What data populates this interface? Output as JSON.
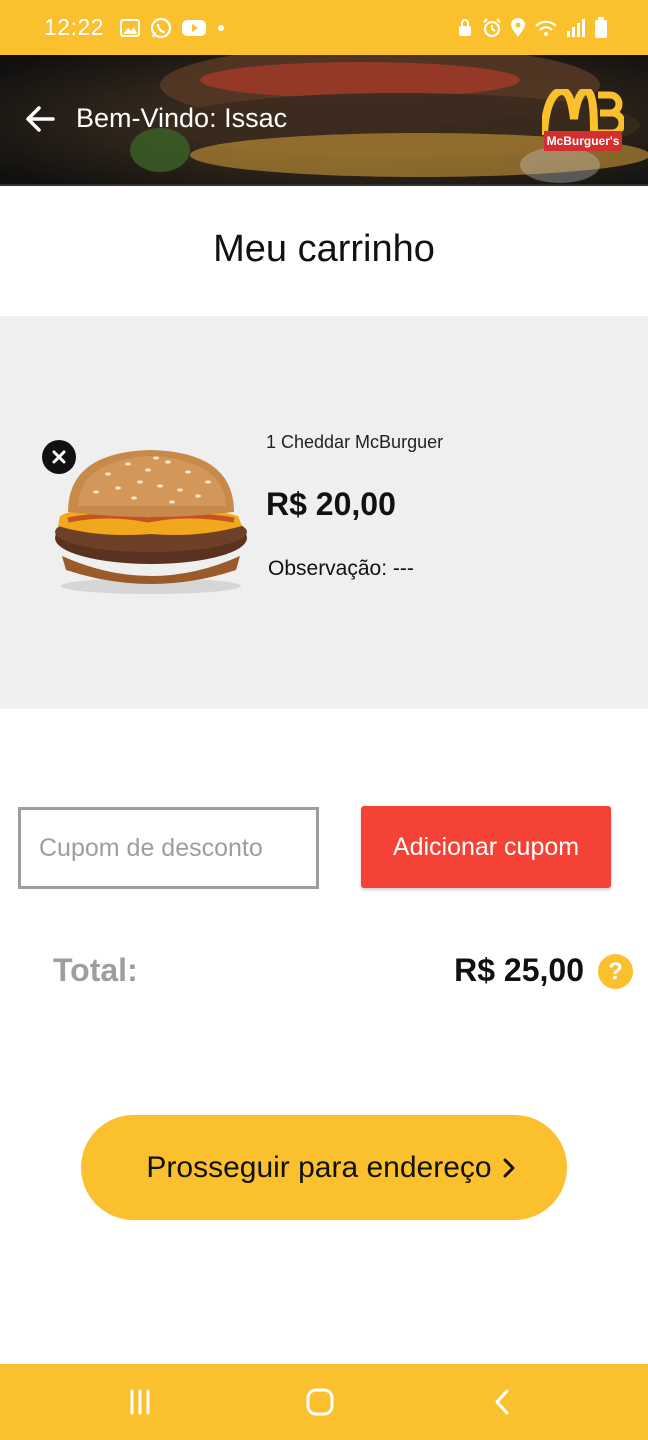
{
  "status_bar": {
    "time": "12:22",
    "left_icons": [
      "gallery-icon",
      "whatsapp-icon",
      "youtube-icon",
      "dot-icon"
    ],
    "right_icons": [
      "lock-icon",
      "alarm-icon",
      "location-icon",
      "wifi-icon",
      "signal-icon",
      "battery-icon"
    ]
  },
  "header": {
    "title": "Bem-Vindo: Issac",
    "logo_text": "McBurguer's"
  },
  "page": {
    "title": "Meu carrinho"
  },
  "cart": {
    "items": [
      {
        "name": "1 Cheddar McBurguer",
        "price": "R$ 20,00",
        "observation": "Observação: ---"
      }
    ]
  },
  "coupon": {
    "placeholder": "Cupom de desconto",
    "button_label": "Adicionar cupom"
  },
  "total": {
    "label": "Total:",
    "value": "R$ 25,00",
    "help_glyph": "?"
  },
  "proceed": {
    "label": "Prosseguir para endereço"
  },
  "colors": {
    "primary_yellow": "#fbc02d",
    "coupon_red": "#f44336",
    "panel_gray": "#efefef"
  }
}
